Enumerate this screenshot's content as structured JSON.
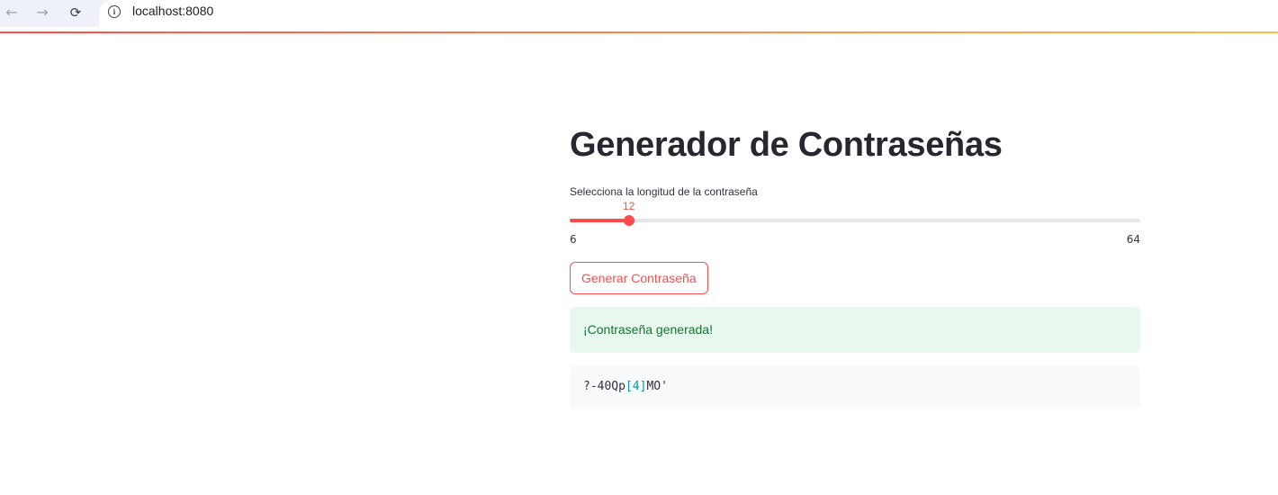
{
  "browser": {
    "back_icon": "←",
    "forward_icon": "→",
    "reload_icon": "⟳",
    "info_icon": "i",
    "url": "localhost:8080"
  },
  "colors": {
    "accent": "#ff4b4b",
    "success_bg": "#e8f8ee",
    "success_text": "#177233",
    "code_bg": "#f8f9fb"
  },
  "app": {
    "title": "Generador de Contraseñas",
    "slider": {
      "label": "Selecciona la longitud de la contraseña",
      "value": 12,
      "value_label": "12",
      "min": 6,
      "max": 64,
      "min_label": "6",
      "max_label": "64"
    },
    "button_label": "Generar Contraseña",
    "success_message": "¡Contraseña generada!",
    "password": {
      "before": "?-40Qp",
      "open_bracket": "[",
      "digit": "4",
      "close_bracket": "]",
      "after": "MO'"
    }
  }
}
